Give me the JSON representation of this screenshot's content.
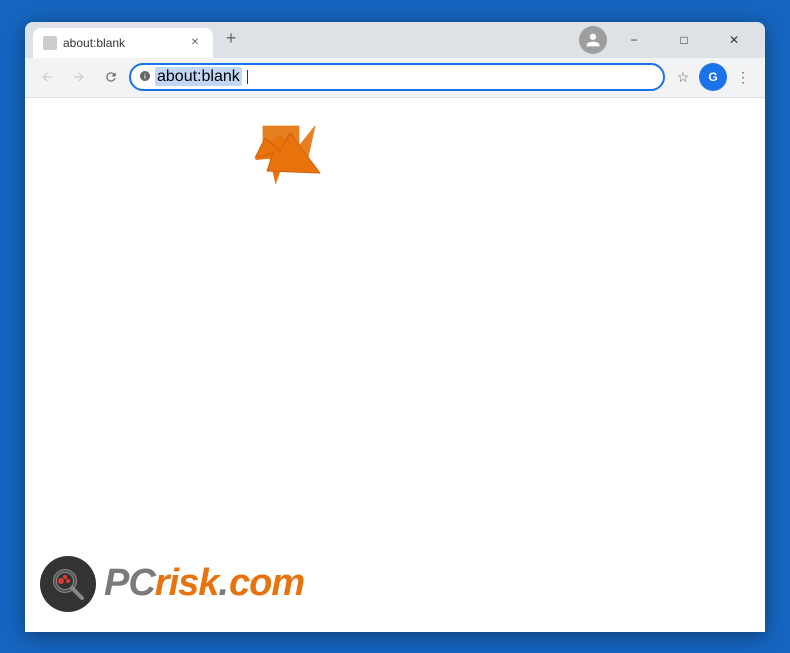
{
  "browser": {
    "tab": {
      "label": "about:blank",
      "icon": "page-icon"
    },
    "window_controls": {
      "minimize": "−",
      "maximize": "□",
      "close": "✕"
    },
    "nav": {
      "back_title": "Back",
      "forward_title": "Forward",
      "refresh_title": "Reload",
      "address": "about:blank",
      "address_selected": true
    },
    "profile_icon": "👤",
    "bookmark_icon": "☆",
    "google_label": "G",
    "menu_icon": "⋮"
  },
  "page": {
    "content": "",
    "arrow_present": true
  },
  "branding": {
    "logo_alt": "PCrisk magnifying glass logo",
    "pc_text": "PC",
    "risk_text": "risk",
    "dot_text": ".",
    "com_text": "com"
  }
}
